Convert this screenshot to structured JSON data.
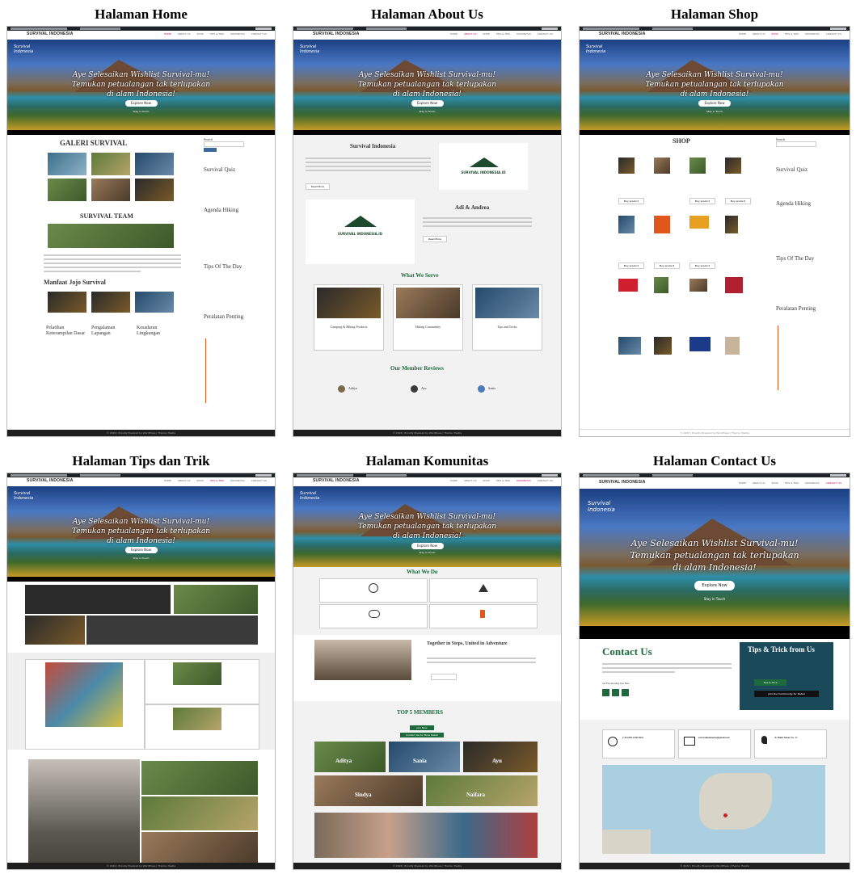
{
  "panels": [
    {
      "caption": "Halaman Home"
    },
    {
      "caption": "Halaman About Us"
    },
    {
      "caption": "Halaman Shop"
    },
    {
      "caption": "Halaman Tips dan Trik"
    },
    {
      "caption": "Halaman Komunitas"
    },
    {
      "caption": "Halaman Contact Us"
    }
  ],
  "site": {
    "brand": "SURVIVAL INDONESIA",
    "menu": [
      "HOME",
      "ABOUT US",
      "SHOP",
      "TIPS & TRIK",
      "KOMUNITAS",
      "CONTACT US"
    ],
    "hero_line1": "Aye Selesaikan Wishlist Survival-mu!",
    "hero_line2": "Temukan petualangan tak terlupakan",
    "hero_line3": "di alam Indonesia!",
    "hero_button": "Explore Now",
    "hero_sub": "Stay in Touch",
    "logo_line1": "Survival",
    "logo_line2": "Indonesia",
    "footer": "© 2022 | Proudly Powered by WordPress | Theme: Hestia"
  },
  "home": {
    "galeri": "GALERI SURVIVAL",
    "team": "SURVIVAL TEAM",
    "manfaat": "Manfaat Jojo Survival",
    "search": "Search",
    "quiz": "Survival Quiz",
    "agenda": "Agenda Hiking",
    "tips": "Tips Of The Day",
    "peralatan": "Peralatan Penting",
    "col1": "Pelatihan Keterampilan Dasar",
    "col2": "Pengalaman Lapangan",
    "col3": "Kesadaran Lingkungan"
  },
  "about": {
    "title": "Survival Indonesia",
    "adi": "Adi & Andrea",
    "serve": "What We Serve",
    "reviews": "Our Member Reviews",
    "s1": "Camping & Hiking Products",
    "s2": "Hiking Community",
    "s3": "Tips and Tricks",
    "r1": "Aditya",
    "r2": "Ayu",
    "r3": "Sania",
    "btn": "Read More",
    "logo": "SURVIVAL INDONESIA.ID"
  },
  "shop": {
    "title": "SHOP",
    "quiz": "Survival Quiz",
    "agenda": "Agenda Hiking",
    "tips": "Tips Of The Day",
    "peralatan": "Peralatan Penting",
    "buy": "Buy product",
    "sale": "Sale!",
    "search": "Search"
  },
  "komunitas": {
    "whatwedo": "What We Do",
    "together": "Together in Steps, United in Adventure",
    "top5": "TOP 5 MEMBERS",
    "m1": "Aditya",
    "m2": "Sania",
    "m3": "Ayu",
    "m4": "Sindya",
    "m5": "Naifara",
    "btn1": "Join Now",
    "btn2": "Contact Us for More Detail"
  },
  "contact": {
    "title": "Contact Us",
    "tips": "Tips & Trick from Us",
    "t1": "Tips & Trick",
    "t2": "Join Our Community for Detail",
    "phone": "(+62) 895-1550-9622",
    "email": "survivalindonesia@gmail.com",
    "address": "Jl. Bukit Tukar No. 17",
    "follow": "Get Free Reading Tips Here"
  },
  "colors": {
    "accent": "#1d6b3c",
    "hero_sky": "#1b3f82",
    "footer": "#1e1e1e",
    "badge": "#5aa02c",
    "sidebar_line": "#e0561d"
  }
}
